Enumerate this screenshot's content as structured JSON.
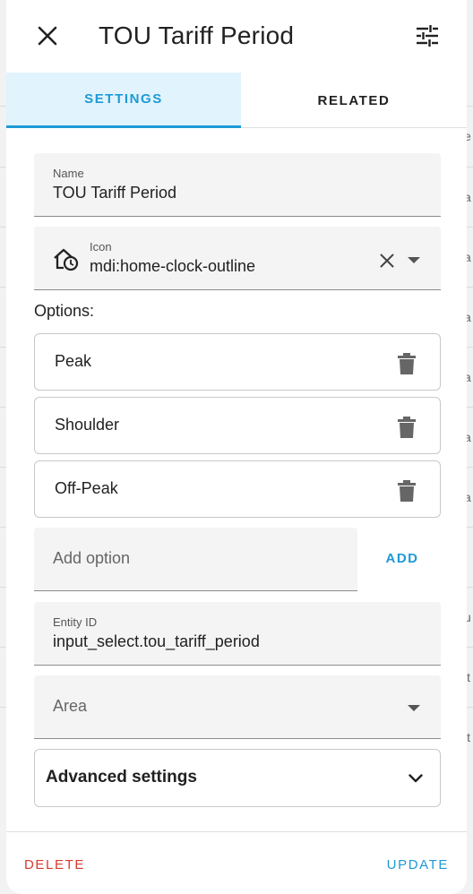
{
  "dialog": {
    "title": "TOU Tariff Period"
  },
  "tabs": [
    {
      "label": "SETTINGS",
      "active": true
    },
    {
      "label": "RELATED",
      "active": false
    }
  ],
  "name_field": {
    "label": "Name",
    "value": "TOU Tariff Period"
  },
  "icon_field": {
    "label": "Icon",
    "value": "mdi:home-clock-outline",
    "icon": "home-clock-outline-icon"
  },
  "options": {
    "label": "Options:",
    "items": [
      "Peak",
      "Shoulder",
      "Off-Peak"
    ]
  },
  "add_option": {
    "placeholder": "Add option",
    "button_label": "ADD"
  },
  "entity_id_field": {
    "label": "Entity ID",
    "value": "input_select.tou_tariff_period"
  },
  "area_field": {
    "placeholder": "Area"
  },
  "advanced": {
    "label": "Advanced settings"
  },
  "footer": {
    "delete_label": "DELETE",
    "update_label": "UPDATE"
  },
  "background": {
    "letters": [
      "e",
      "a",
      "a",
      "a",
      "a",
      "a",
      "a",
      "u",
      "it",
      "it"
    ]
  },
  "colors": {
    "accent": "#1e9ad6",
    "danger": "#db3b2e",
    "active_tab_bg": "#e1f3fd"
  }
}
